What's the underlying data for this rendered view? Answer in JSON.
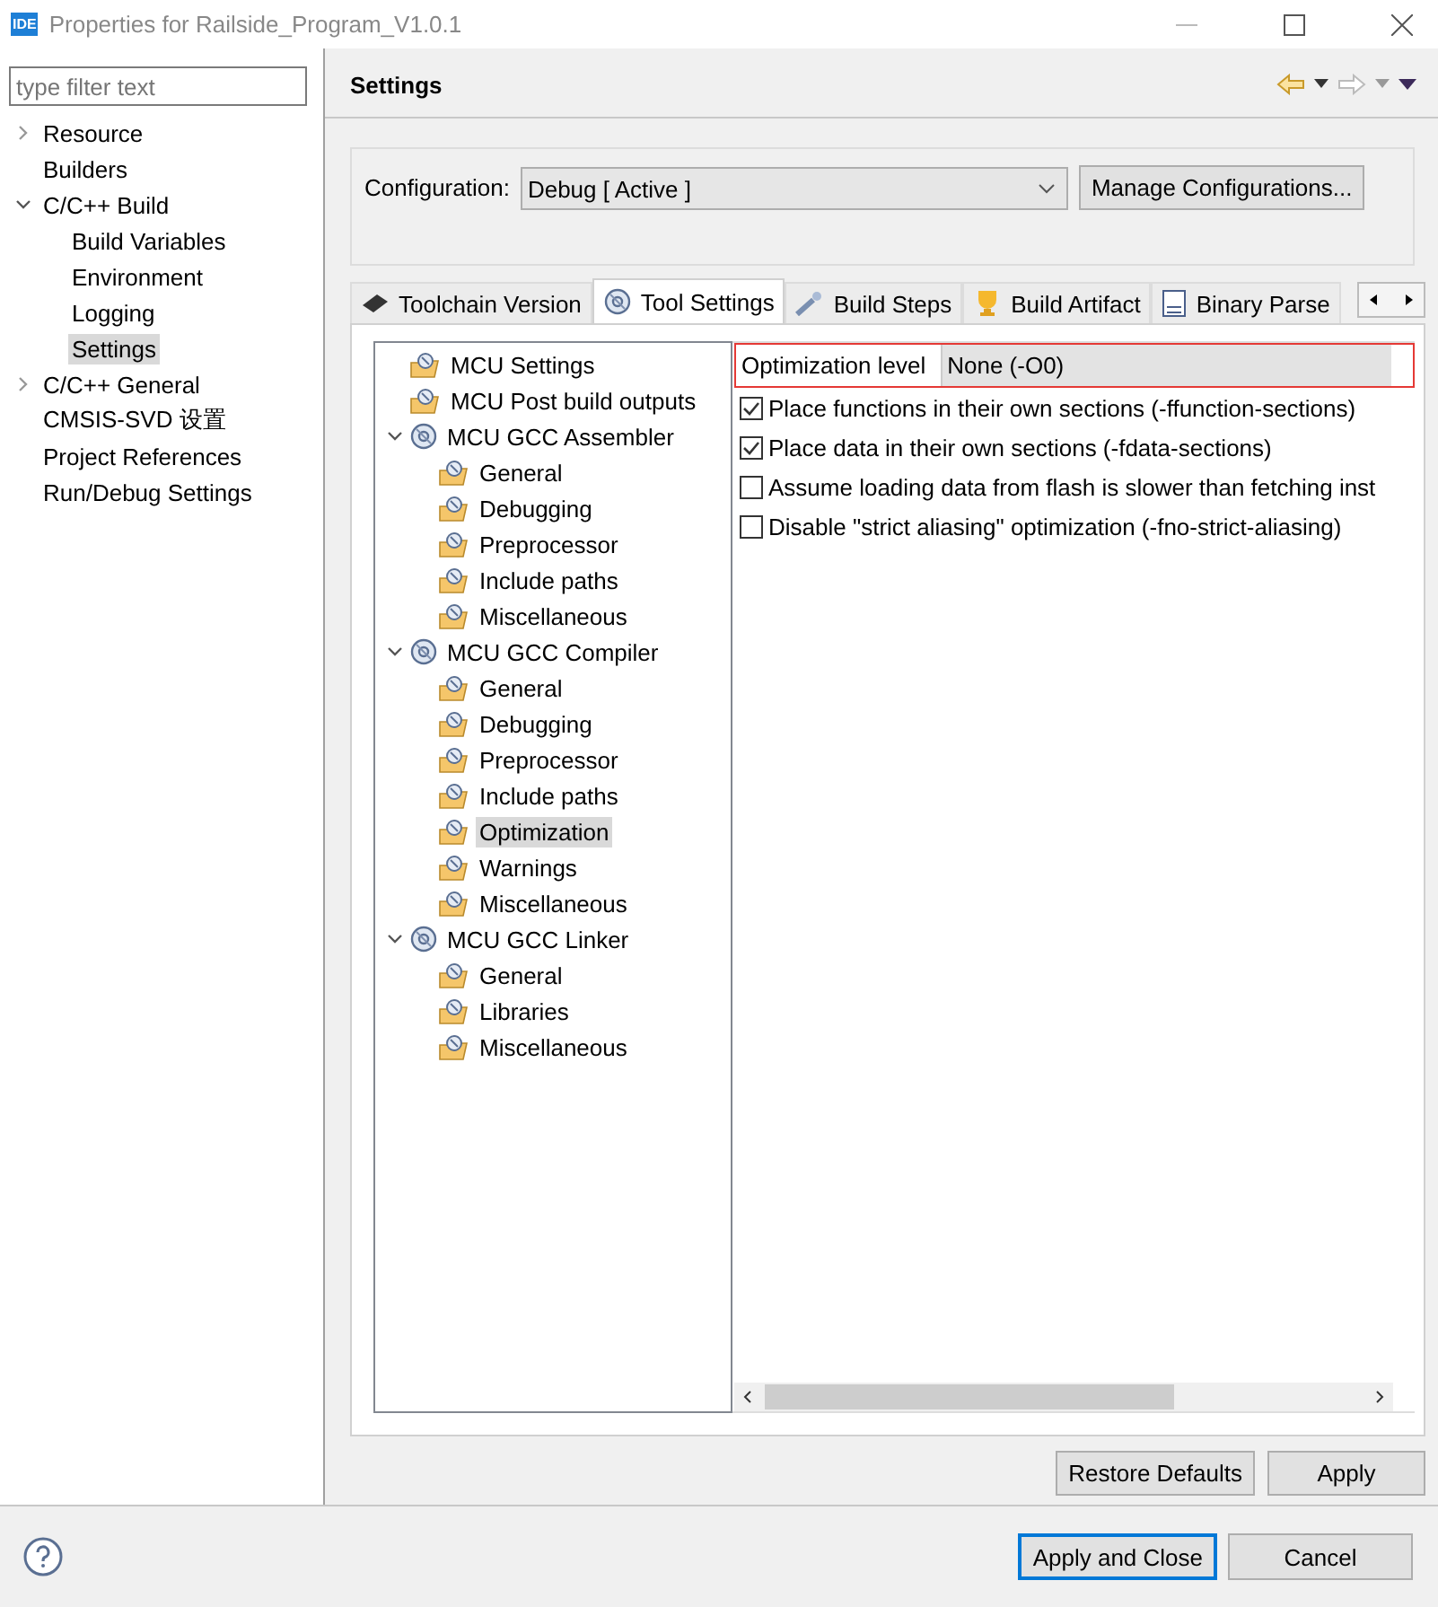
{
  "window": {
    "title": "Properties for Railside_Program_V1.0.1",
    "app_badge": "IDE"
  },
  "sidebar": {
    "filter": {
      "placeholder": "type filter text"
    },
    "items": [
      {
        "label": "Resource",
        "expanded": false,
        "selected": false
      },
      {
        "label": "Builders",
        "selected": false
      },
      {
        "label": "C/C++ Build",
        "expanded": true,
        "selected": false,
        "children": [
          {
            "label": "Build Variables",
            "selected": false
          },
          {
            "label": "Environment",
            "selected": false
          },
          {
            "label": "Logging",
            "selected": false
          },
          {
            "label": "Settings",
            "selected": true
          }
        ]
      },
      {
        "label": "C/C++ General",
        "expanded": false,
        "selected": false
      },
      {
        "label": "CMSIS-SVD 设置",
        "selected": false
      },
      {
        "label": "Project References",
        "selected": false
      },
      {
        "label": "Run/Debug Settings",
        "selected": false
      }
    ]
  },
  "page": {
    "title": "Settings",
    "configuration": {
      "label": "Configuration:",
      "value": "Debug  [ Active ]",
      "button": "Manage Configurations..."
    },
    "tabs": [
      {
        "label": "Toolchain  Version",
        "selected": false
      },
      {
        "label": "Tool Settings",
        "selected": true
      },
      {
        "label": "Build Steps",
        "selected": false
      },
      {
        "label": "Build Artifact",
        "selected": false
      },
      {
        "label": "Binary Parse",
        "selected": false
      }
    ],
    "tool_tree": [
      {
        "label": "MCU Settings",
        "kind": "page",
        "selected": false
      },
      {
        "label": "MCU Post build outputs",
        "kind": "page",
        "selected": false
      },
      {
        "label": "MCU GCC Assembler",
        "kind": "tool",
        "expanded": true,
        "selected": false,
        "children": [
          {
            "label": "General",
            "kind": "page",
            "selected": false
          },
          {
            "label": "Debugging",
            "kind": "page",
            "selected": false
          },
          {
            "label": "Preprocessor",
            "kind": "page",
            "selected": false
          },
          {
            "label": "Include paths",
            "kind": "page",
            "selected": false
          },
          {
            "label": "Miscellaneous",
            "kind": "page",
            "selected": false
          }
        ]
      },
      {
        "label": "MCU GCC Compiler",
        "kind": "tool",
        "expanded": true,
        "selected": false,
        "children": [
          {
            "label": "General",
            "kind": "page",
            "selected": false
          },
          {
            "label": "Debugging",
            "kind": "page",
            "selected": false
          },
          {
            "label": "Preprocessor",
            "kind": "page",
            "selected": false
          },
          {
            "label": "Include paths",
            "kind": "page",
            "selected": false
          },
          {
            "label": "Optimization",
            "kind": "page",
            "selected": true
          },
          {
            "label": "Warnings",
            "kind": "page",
            "selected": false
          },
          {
            "label": "Miscellaneous",
            "kind": "page",
            "selected": false
          }
        ]
      },
      {
        "label": "MCU GCC Linker",
        "kind": "tool",
        "expanded": true,
        "selected": false,
        "children": [
          {
            "label": "General",
            "kind": "page",
            "selected": false
          },
          {
            "label": "Libraries",
            "kind": "page",
            "selected": false
          },
          {
            "label": "Miscellaneous",
            "kind": "page",
            "selected": false
          }
        ]
      }
    ],
    "options": [
      {
        "kind": "combo",
        "label": "Optimization level",
        "value": "None (-O0)",
        "highlighted": true
      },
      {
        "kind": "checkbox",
        "label": "Place functions in their own sections (-ffunction-sections)",
        "checked": true
      },
      {
        "kind": "checkbox",
        "label": "Place data in their own sections (-fdata-sections)",
        "checked": true
      },
      {
        "kind": "checkbox",
        "label": "Assume loading data from flash is slower than fetching inst",
        "checked": false
      },
      {
        "kind": "checkbox",
        "label": "Disable \"strict aliasing\" optimization (-fno-strict-aliasing)",
        "checked": false
      }
    ],
    "buttons": [
      "Restore Defaults",
      "Apply"
    ]
  },
  "footer": {
    "buttons": [
      {
        "label": "Apply and Close",
        "default": true
      },
      {
        "label": "Cancel",
        "default": false
      }
    ]
  }
}
